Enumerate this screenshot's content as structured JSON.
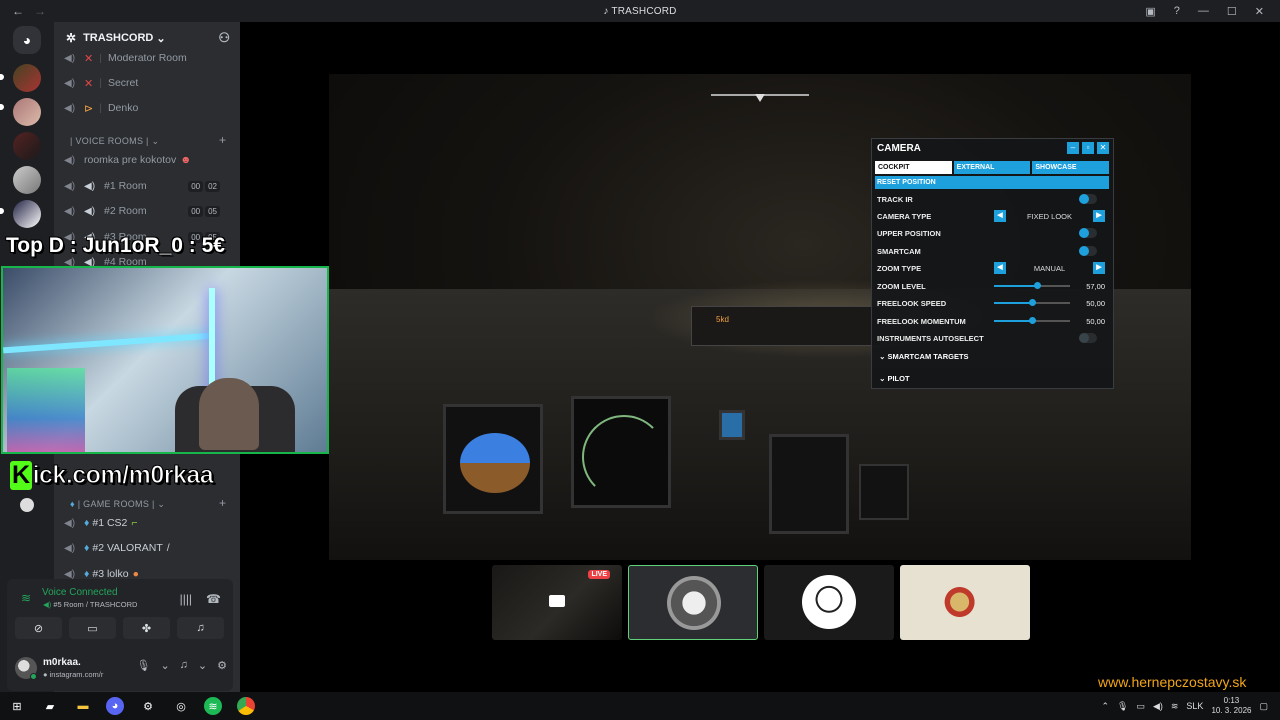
{
  "window": {
    "title": "TRASHCORD",
    "nav_back": "←",
    "nav_forward": "→"
  },
  "server": {
    "name": "TRASHCORD"
  },
  "channels": {
    "top": [
      {
        "name": "Moderator Room",
        "mark": "✕"
      },
      {
        "name": "Secret",
        "mark": "✕"
      },
      {
        "name": "Denko",
        "mark": "⊳"
      }
    ],
    "voice_category": "| VOICE ROOMS |",
    "voice": [
      {
        "name": "roomka pre kokotov"
      },
      {
        "name": "#1 Room",
        "c1": "00",
        "c2": "02"
      },
      {
        "name": "#2 Room",
        "c1": "00",
        "c2": "05"
      },
      {
        "name": "#3 Room",
        "c1": "00",
        "c2": "05"
      },
      {
        "name": "#4 Room"
      }
    ],
    "game_category": "| GAME ROOMS |",
    "game": [
      {
        "name": "#1 CS2"
      },
      {
        "name": "#2 VALORANT"
      },
      {
        "name": "#3 lolko"
      }
    ]
  },
  "overlay": {
    "top_donor": "Top D : Jun1oR_0 : 5€",
    "kick_k": "K",
    "kick_rest": "ick.com/m0rkaa"
  },
  "voice_panel": {
    "status": "Voice Connected",
    "location": "#5 Room / TRASHCORD"
  },
  "user": {
    "name": "m0rkaa.",
    "status": "instagram.com/r"
  },
  "camera_panel": {
    "title": "CAMERA",
    "tabs": [
      "COCKPIT",
      "EXTERNAL",
      "SHOWCASE"
    ],
    "active_tab": "COCKPIT",
    "reset": "RESET POSITION",
    "rows": {
      "track_ir": "TRACK IR",
      "camera_type": "CAMERA TYPE",
      "camera_type_value": "FIXED LOOK",
      "upper_position": "UPPER POSITION",
      "smartcam": "SMARTCAM",
      "zoom_type": "ZOOM TYPE",
      "zoom_type_value": "MANUAL",
      "zoom_level": "ZOOM LEVEL",
      "zoom_level_value": "57,00",
      "freelook_speed": "FREELOOK SPEED",
      "freelook_speed_value": "50,00",
      "freelook_momentum": "FREELOOK MOMENTUM",
      "freelook_momentum_value": "50,00",
      "instruments_autoselect": "INSTRUMENTS AUTOSELECT",
      "smartcam_targets": "SMARTCAM TARGETS",
      "pilot": "PILOT"
    },
    "levels": {
      "zoom_level": 0.57,
      "freelook_speed": 0.5,
      "freelook_momentum": 0.5
    }
  },
  "stream": {
    "live_badge": "LIVE",
    "fcu_readout": "5kd"
  },
  "watermark": "www.hernepczostavy.sk",
  "taskbar": {
    "lang": "SLK",
    "time": "0:13",
    "date": "10. 3. 2026"
  },
  "colors": {
    "accent": "#1ea0dd",
    "voice_green": "#23a55a",
    "live_red": "#ed4245",
    "watermark": "#f2a51a",
    "kick_green": "#53fc18"
  }
}
